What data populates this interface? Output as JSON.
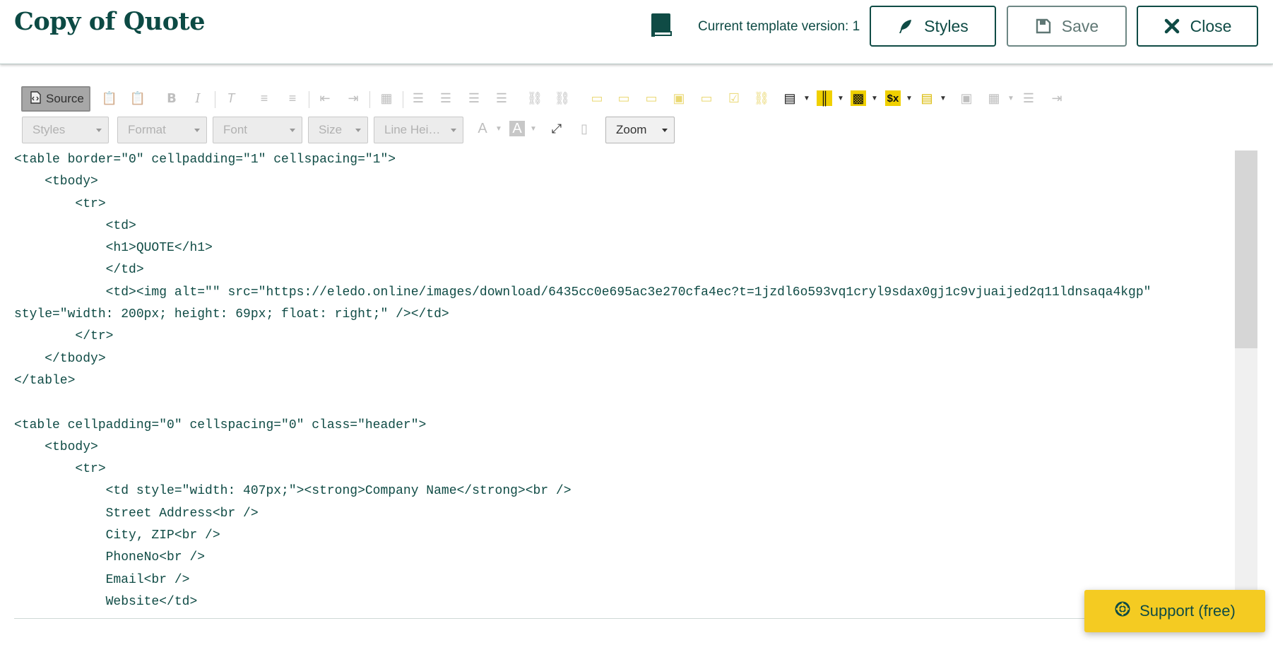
{
  "header": {
    "title": "Copy of Quote",
    "version_text": "Current template version: 1",
    "styles_label": "Styles",
    "save_label": "Save",
    "close_label": "Close"
  },
  "toolbar": {
    "source_label": "Source",
    "styles_dd": "Styles",
    "format_dd": "Format",
    "font_dd": "Font",
    "size_dd": "Size",
    "lineheight_dd": "Line Hei…",
    "zoom_dd": "Zoom"
  },
  "editor": {
    "code": "<table border=\"0\" cellpadding=\"1\" cellspacing=\"1\">\n    <tbody>\n        <tr>\n            <td>\n            <h1>QUOTE</h1>\n            </td>\n            <td><img alt=\"\" src=\"https://eledo.online/images/download/6435cc0e695ac3e270cfa4ec?t=1jzdl6o593vq1cryl9sdax0gj1c9vjuaijed2q11ldnsaqa4kgp\"\nstyle=\"width: 200px; height: 69px; float: right;\" /></td>\n        </tr>\n    </tbody>\n</table>\n\n<table cellpadding=\"0\" cellspacing=\"0\" class=\"header\">\n    <tbody>\n        <tr>\n            <td style=\"width: 407px;\"><strong>Company Name</strong><br />\n            Street Address<br />\n            City, ZIP<br />\n            PhoneNo<br />\n            Email<br />\n            Website</td>"
  },
  "support": {
    "label": "Support (free)"
  },
  "colors": {
    "brand": "#0f4b45",
    "support_bg": "#f4cb22"
  }
}
